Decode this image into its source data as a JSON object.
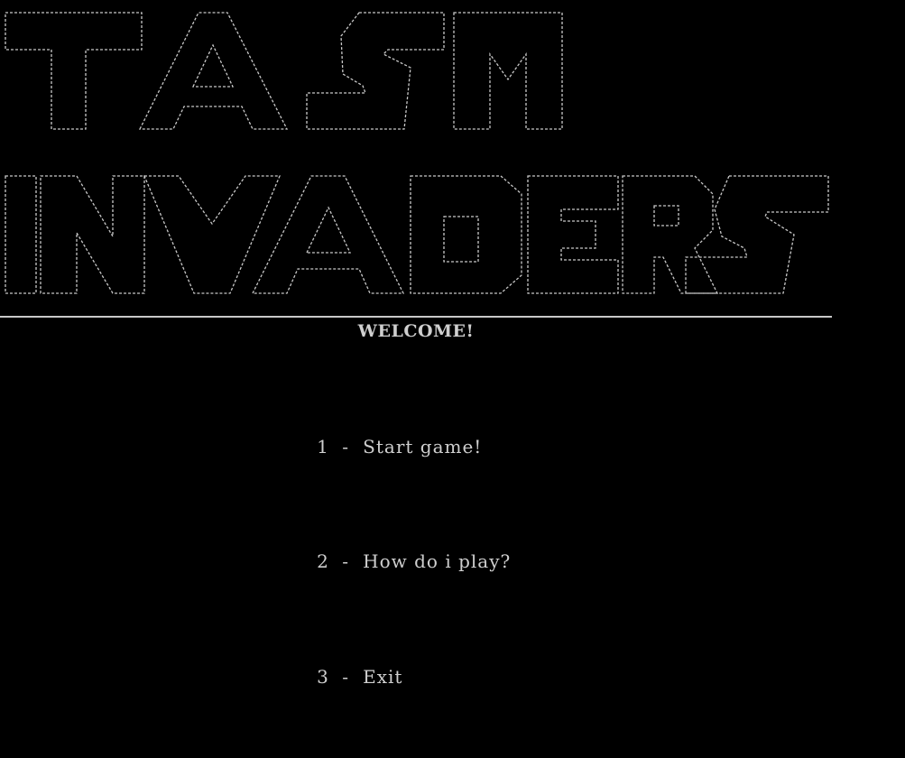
{
  "logo": {
    "line1": "TASM",
    "line2": "INVADERS",
    "style": "ascii-art-outline",
    "color": "#c8c8c8"
  },
  "welcome": "WELCOME!",
  "menu": [
    {
      "key": "1",
      "separator": "-",
      "label": "Start game!"
    },
    {
      "key": "2",
      "separator": "-",
      "label": "How do i play?"
    },
    {
      "key": "3",
      "separator": "-",
      "label": "Exit"
    }
  ],
  "colors": {
    "background": "#000000",
    "text": "#cfcfcf"
  }
}
